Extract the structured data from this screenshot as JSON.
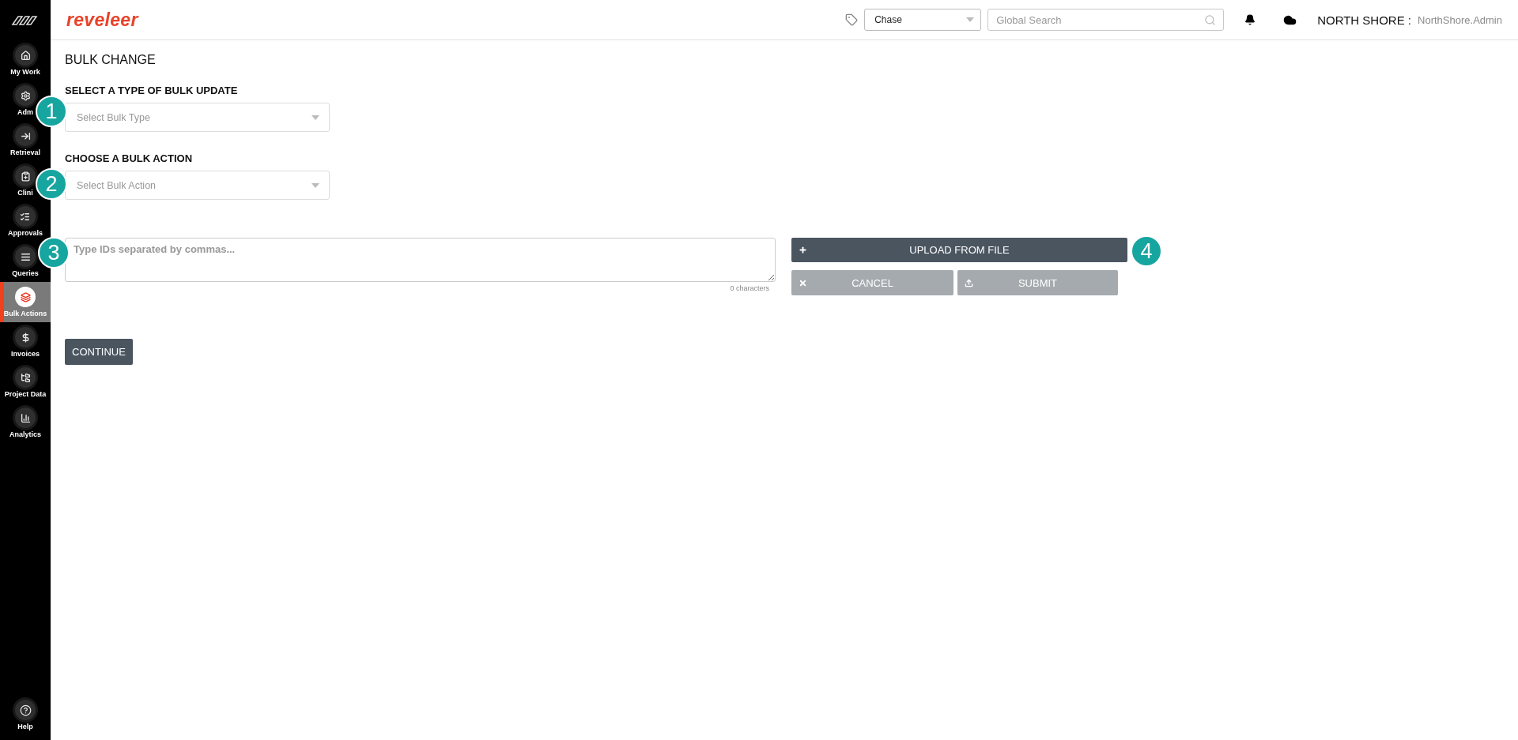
{
  "sidebar": {
    "items": [
      {
        "label": "My Work",
        "selected": false
      },
      {
        "label": "Adm",
        "selected": false
      },
      {
        "label": "Retrieval",
        "selected": false
      },
      {
        "label": "Clini",
        "selected": false
      },
      {
        "label": "Approvals",
        "selected": false
      },
      {
        "label": "Queries",
        "selected": false
      },
      {
        "label": "Bulk Actions",
        "selected": true
      },
      {
        "label": "Invoices",
        "selected": false
      },
      {
        "label": "Project Data",
        "selected": false
      },
      {
        "label": "Analytics",
        "selected": false
      }
    ],
    "help": "Help"
  },
  "header": {
    "logo": "reveleer",
    "project_select": {
      "value": "Chase"
    },
    "search": {
      "placeholder": "Global Search"
    },
    "org": "NORTH SHORE :",
    "user": "NorthShore.Admin"
  },
  "page": {
    "title": "BULK CHANGE",
    "fields": [
      {
        "label": "SELECT A TYPE OF BULK UPDATE",
        "placeholder": "Select Bulk Type"
      },
      {
        "label": "CHOOSE A BULK ACTION",
        "placeholder": "Select Bulk Action"
      }
    ],
    "ids_field": {
      "placeholder": "Type IDs separated by commas...",
      "counter": "0 characters"
    },
    "upload_button": {
      "label": "UPLOAD FROM FILE",
      "disabled": false
    },
    "cancel_button": {
      "label": "CANCEL",
      "disabled": true
    },
    "submit_button": {
      "label": "SUBMIT",
      "disabled": true
    },
    "continue_button": {
      "label": "CONTINUE"
    }
  },
  "callouts": [
    {
      "label": "1"
    },
    {
      "label": "2"
    },
    {
      "label": "3"
    },
    {
      "label": "4"
    }
  ]
}
